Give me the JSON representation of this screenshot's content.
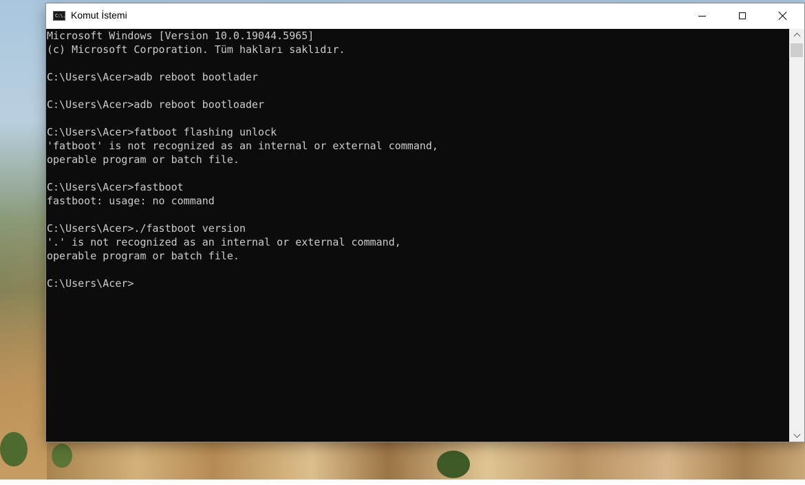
{
  "window": {
    "title": "Komut İstemi",
    "app_icon_text": "C:\\."
  },
  "title_buttons": {
    "minimize": "minimize-icon",
    "maximize": "maximize-icon",
    "close": "close-icon"
  },
  "console": {
    "lines": [
      "Microsoft Windows [Version 10.0.19044.5965]",
      "(c) Microsoft Corporation. Tüm hakları saklıdır.",
      "",
      "C:\\Users\\Acer>adb reboot bootlader",
      "",
      "C:\\Users\\Acer>adb reboot bootloader",
      "",
      "C:\\Users\\Acer>fatboot flashing unlock",
      "'fatboot' is not recognized as an internal or external command,",
      "operable program or batch file.",
      "",
      "C:\\Users\\Acer>fastboot",
      "fastboot: usage: no command",
      "",
      "C:\\Users\\Acer>./fastboot version",
      "'.' is not recognized as an internal or external command,",
      "operable program or batch file.",
      "",
      "C:\\Users\\Acer>"
    ]
  },
  "colors": {
    "console_bg": "#0c0c0c",
    "console_fg": "#cccccc",
    "titlebar_bg": "#ffffff",
    "scrollbar_bg": "#f0f0f0"
  }
}
